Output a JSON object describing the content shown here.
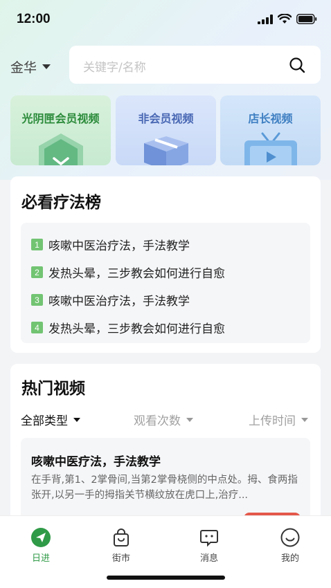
{
  "status": {
    "time": "12:00"
  },
  "search": {
    "city": "金华",
    "placeholder": "关键字/名称"
  },
  "categories": [
    {
      "label": "光阴匣会员视频"
    },
    {
      "label": "非会员视频"
    },
    {
      "label": "店长视频"
    }
  ],
  "ranking": {
    "title": "必看疗法榜",
    "items": [
      {
        "num": "1",
        "text": "咳嗽中医治疗法，手法教学"
      },
      {
        "num": "2",
        "text": "发热头晕，三步教会如何进行自愈"
      },
      {
        "num": "3",
        "text": "咳嗽中医治疗法，手法教学"
      },
      {
        "num": "4",
        "text": "发热头晕，三步教会如何进行自愈"
      }
    ]
  },
  "hot": {
    "title": "热门视频",
    "filters": {
      "type": "全部类型",
      "views": "观看次数",
      "upload": "上传时间"
    },
    "video": {
      "title": "咳嗽中医疗法，手法教学",
      "desc": "在手背,第1、2掌骨间,当第2掌骨桡侧的中点处。拇、食两指张开,以另一手的拇指关节横纹放在虎口上,治疗..."
    }
  },
  "tabbar": [
    {
      "label": "日进",
      "icon": "send-icon",
      "active": true
    },
    {
      "label": "街市",
      "icon": "shopping-bag-icon",
      "active": false
    },
    {
      "label": "消息",
      "icon": "message-icon",
      "active": false
    },
    {
      "label": "我的",
      "icon": "smile-icon",
      "active": false
    }
  ],
  "colors": {
    "accent": "#2f9a47",
    "rank_badge": "#72c472"
  }
}
